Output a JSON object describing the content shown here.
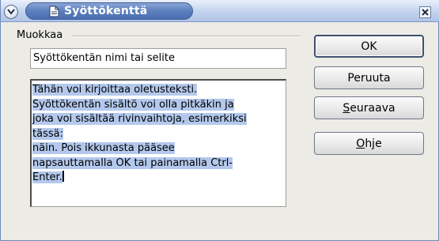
{
  "window": {
    "title": "Syöttökenttä"
  },
  "group": {
    "label": "Muokkaa"
  },
  "name_field": {
    "value": "Syöttökentän nimi tai selite"
  },
  "content": {
    "lines": [
      "Tähän voi kirjoittaa oletusteksti.",
      "Syöttökentän sisältö voi olla pitkäkin ja",
      "joka voi sisältää rivinvaihtoja, esimerkiksi",
      "tässä:",
      "näin. Pois ikkunasta pääsee",
      "napsauttamalla OK tai painamalla Ctrl-",
      "Enter."
    ],
    "selected": true
  },
  "buttons": {
    "ok": "OK",
    "cancel": "Peruuta",
    "next_first": "S",
    "next_rest": "euraava",
    "help_first": "O",
    "help_rest": "hje"
  },
  "icons": {
    "menu": "chevron-down-icon",
    "title": "document-icon",
    "close": "close-icon"
  },
  "colors": {
    "selection": "#b3c8ec",
    "title_pill": "#5c7fbd",
    "window_bg": "#ecebe6"
  }
}
